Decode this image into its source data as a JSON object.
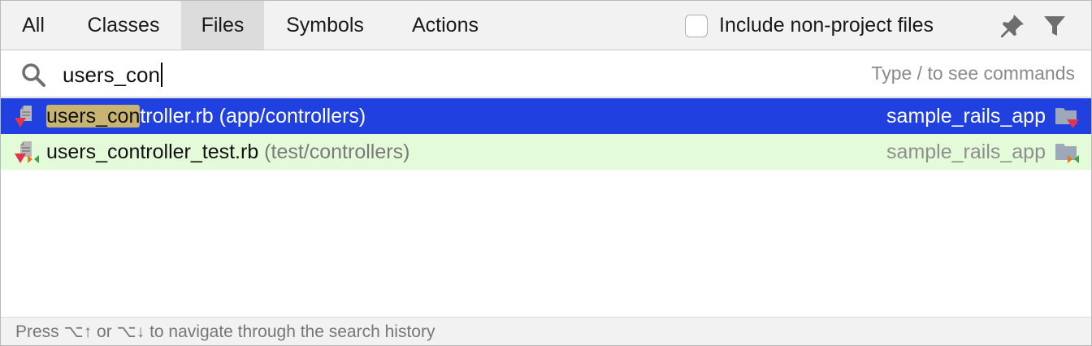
{
  "tabs": {
    "all": "All",
    "classes": "Classes",
    "files": "Files",
    "symbols": "Symbols",
    "actions": "Actions"
  },
  "include_non_project": {
    "label": "Include non-project files",
    "checked": false
  },
  "icons": {
    "pin": "pin-icon",
    "filter": "filter-icon",
    "search": "search-icon",
    "ruby_file": "ruby-file-icon",
    "ruby_test_file": "ruby-test-file-icon",
    "module_folder": "module-folder-icon"
  },
  "search": {
    "value": "users_con",
    "hint": "Type / to see commands"
  },
  "results": [
    {
      "match": "users_con",
      "rest": "troller.rb",
      "path": " (app/controllers)",
      "module": "sample_rails_app"
    },
    {
      "match": "users_controller_test.rb",
      "rest": "",
      "path": " (test/controllers)",
      "module": "sample_rails_app"
    }
  ],
  "footer": {
    "hint": "Press ⌥↑ or ⌥↓ to navigate through the search history"
  },
  "colors": {
    "selected_row": "#2040e0",
    "test_row": "#e4fbd9",
    "match_highlight": "#c8b370"
  }
}
